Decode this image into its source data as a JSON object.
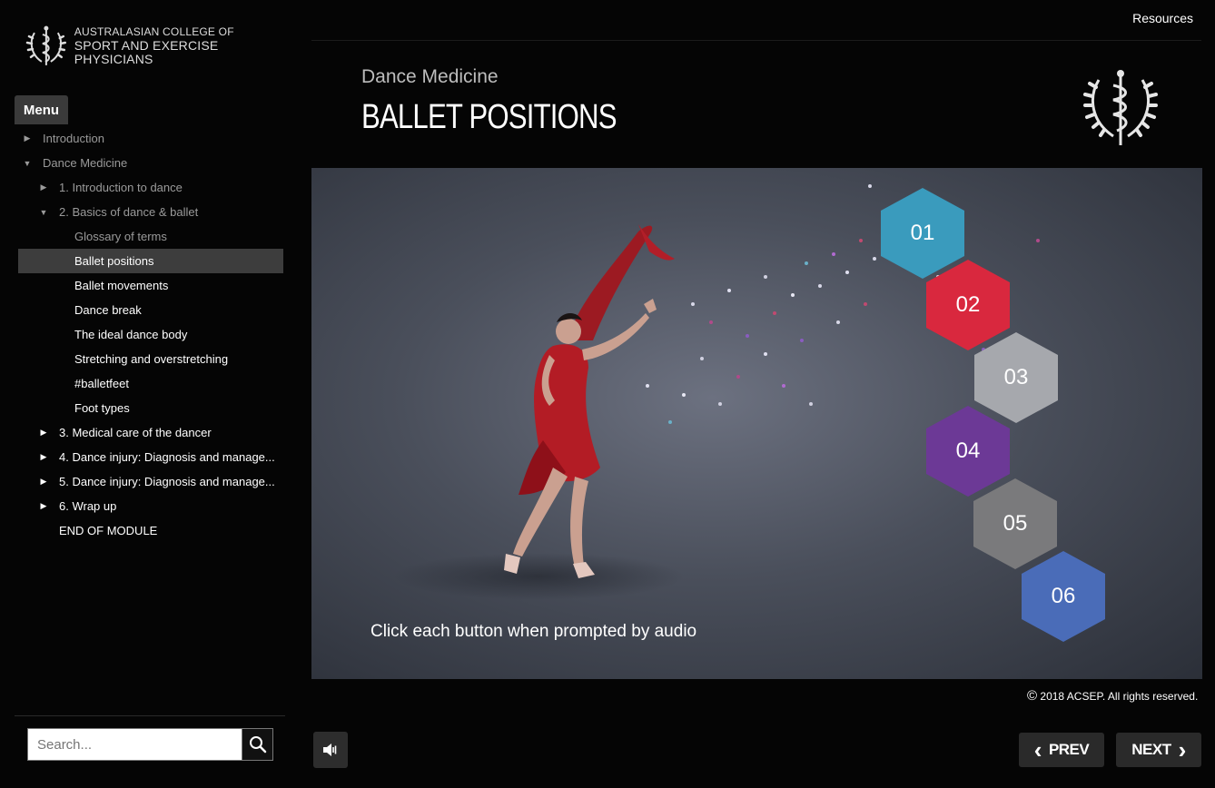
{
  "sidebar": {
    "logo_line1": "AUSTRALASIAN COLLEGE OF",
    "logo_line2": "SPORT AND EXERCISE PHYSICIANS",
    "menu_tab": "Menu",
    "items": [
      {
        "label": "Introduction",
        "arrow": "▶"
      },
      {
        "label": "Dance Medicine",
        "arrow": "▼"
      },
      {
        "label": "1. Introduction to dance",
        "arrow": "▶"
      },
      {
        "label": "2. Basics of dance & ballet",
        "arrow": "▼"
      },
      {
        "label": "Glossary of terms"
      },
      {
        "label": "Ballet positions"
      },
      {
        "label": "Ballet movements"
      },
      {
        "label": "Dance break"
      },
      {
        "label": "The ideal dance body"
      },
      {
        "label": "Stretching and overstretching"
      },
      {
        "label": "#balletfeet"
      },
      {
        "label": "Foot types"
      },
      {
        "label": "3. Medical care of the dancer",
        "arrow": "▶"
      },
      {
        "label": "4. Dance injury: Diagnosis and manage...",
        "arrow": "▶"
      },
      {
        "label": "5. Dance injury: Diagnosis and manage...",
        "arrow": "▶"
      },
      {
        "label": "6. Wrap up",
        "arrow": "▶"
      },
      {
        "label": "END OF MODULE"
      }
    ],
    "search_placeholder": "Search..."
  },
  "header": {
    "resources": "Resources",
    "subtitle": "Dance Medicine",
    "title": "BALLET POSITIONS"
  },
  "stage": {
    "prompt": "Click each button when prompted by audio",
    "hexagons": [
      {
        "label": "01",
        "color": "#3a9bbd"
      },
      {
        "label": "02",
        "color": "#d9283e"
      },
      {
        "label": "03",
        "color": "#a6a8ad"
      },
      {
        "label": "04",
        "color": "#6c3996"
      },
      {
        "label": "05",
        "color": "#7a7a7c"
      },
      {
        "label": "06",
        "color": "#4a6cb8"
      }
    ]
  },
  "footer": {
    "copyright": "2018 ACSEP. All rights reserved.",
    "copyright_symbol": "©",
    "prev": "PREV",
    "next": "NEXT",
    "prev_icon": "‹",
    "next_icon": "›"
  }
}
